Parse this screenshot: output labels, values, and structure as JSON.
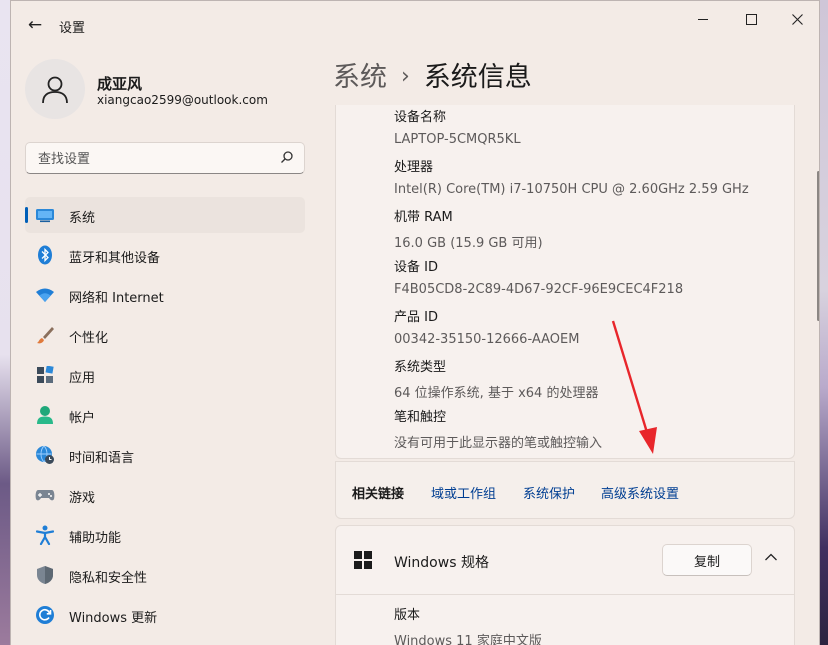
{
  "window": {
    "title": "设置",
    "back_glyph": "←"
  },
  "user": {
    "name": "成亚风",
    "email": "xiangcao2599@outlook.com"
  },
  "search": {
    "placeholder": "查找设置"
  },
  "sidebar": {
    "items": [
      {
        "label": "系统",
        "icon": "monitor-icon",
        "active": true
      },
      {
        "label": "蓝牙和其他设备",
        "icon": "bluetooth-icon"
      },
      {
        "label": "网络和 Internet",
        "icon": "wifi-icon"
      },
      {
        "label": "个性化",
        "icon": "brush-icon"
      },
      {
        "label": "应用",
        "icon": "apps-icon"
      },
      {
        "label": "帐户",
        "icon": "person-icon"
      },
      {
        "label": "时间和语言",
        "icon": "globe-clock-icon"
      },
      {
        "label": "游戏",
        "icon": "gamepad-icon"
      },
      {
        "label": "辅助功能",
        "icon": "accessibility-icon"
      },
      {
        "label": "隐私和安全性",
        "icon": "shield-icon"
      },
      {
        "label": "Windows 更新",
        "icon": "refresh-icon"
      }
    ]
  },
  "breadcrumb": {
    "parent": "系统",
    "separator": "›",
    "current": "系统信息"
  },
  "specs": [
    {
      "label": "设备名称",
      "value": "LAPTOP-5CMQR5KL"
    },
    {
      "label": "处理器",
      "value": "Intel(R) Core(TM) i7-10750H CPU @ 2.60GHz   2.59 GHz"
    },
    {
      "label": "机带 RAM",
      "value": "16.0 GB (15.9 GB 可用)"
    },
    {
      "label": "设备 ID",
      "value": "F4B05CD8-2C89-4D67-92CF-96E9CEC4F218"
    },
    {
      "label": "产品 ID",
      "value": "00342-35150-12666-AAOEM"
    },
    {
      "label": "系统类型",
      "value": "64 位操作系统, 基于 x64 的处理器"
    },
    {
      "label": "笔和触控",
      "value": "没有可用于此显示器的笔或触控输入"
    }
  ],
  "related_links": {
    "title": "相关链接",
    "links": [
      "域或工作组",
      "系统保护",
      "高级系统设置"
    ]
  },
  "windows_spec": {
    "title": "Windows 规格",
    "copy_label": "复制",
    "version_label": "版本",
    "version_value": "Windows 11 家庭中文版"
  },
  "colors": {
    "accent": "#005fb8",
    "link": "#003e92",
    "arrow": "#e8262b",
    "window_bg": "#f3ebe6"
  }
}
